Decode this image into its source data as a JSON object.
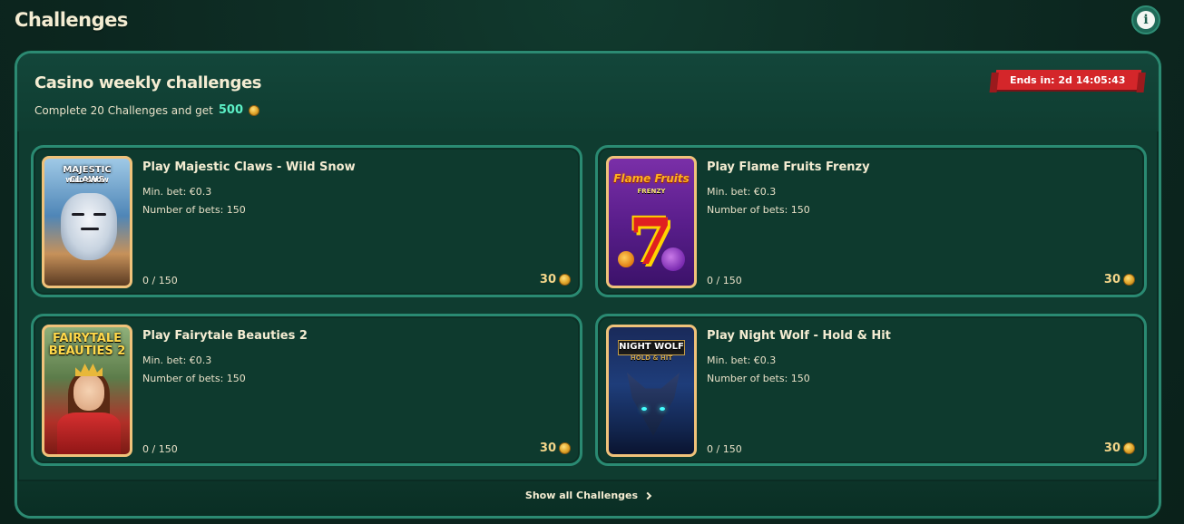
{
  "page": {
    "title": "Challenges"
  },
  "panel": {
    "title": "Casino weekly challenges",
    "subtitle_prefix": "Complete 20 Challenges and get",
    "reward_amount": "500",
    "timer": "Ends in: 2d 14:05:43"
  },
  "challenges": [
    {
      "title": "Play Majestic Claws - Wild Snow",
      "min_bet": "Min. bet: €0.3",
      "bets": "Number of bets: 150",
      "progress": "0 / 150",
      "reward": "30",
      "thumb_label": "MAJESTIC CLAWS",
      "thumb_sub": "WILD SNOW"
    },
    {
      "title": "Play Flame Fruits Frenzy",
      "min_bet": "Min. bet: €0.3",
      "bets": "Number of bets: 150",
      "progress": "0 / 150",
      "reward": "30",
      "thumb_label": "Flame Fruits",
      "thumb_sub": "FRENZY"
    },
    {
      "title": "Play Fairytale Beauties 2",
      "min_bet": "Min. bet: €0.3",
      "bets": "Number of bets: 150",
      "progress": "0 / 150",
      "reward": "30",
      "thumb_label": "FAIRYTALE BEAUTIES 2"
    },
    {
      "title": "Play Night Wolf - Hold & Hit",
      "min_bet": "Min. bet: €0.3",
      "bets": "Number of bets: 150",
      "progress": "0 / 150",
      "reward": "30",
      "thumb_label": "NIGHT WOLF",
      "thumb_sub": "HOLD & HIT"
    }
  ],
  "footer": {
    "show_all_label": "Show all Challenges"
  },
  "icons": {
    "info": "info-icon",
    "coin": "coin-icon",
    "chevron": "chevron-right-icon"
  },
  "colors": {
    "accent": "#5cf0c6",
    "timer_bg": "#d4262a",
    "card_border": "#2a8a72"
  }
}
